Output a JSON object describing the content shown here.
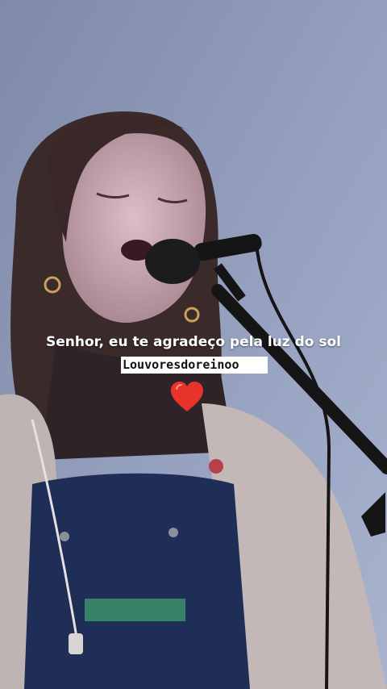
{
  "caption": {
    "text": "Senhor, eu te agradeço pela luz do sol"
  },
  "tag": {
    "text": "Louvoresdoreinoo"
  },
  "emoji": {
    "name": "heart-icon",
    "color": "#e8332b"
  },
  "colors": {
    "sky": "#8d9ab9",
    "hair": "#3b2a2a",
    "skin": "#c9a7ae",
    "cardigan": "#bfb4b4",
    "overalls": "#1f2e57",
    "mic": "#151516"
  }
}
